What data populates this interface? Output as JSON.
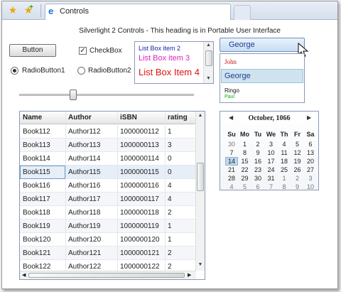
{
  "browser": {
    "tab_title": "Controls",
    "icons": [
      "favorites-star-icon",
      "add-favorite-icon",
      "ie-page-icon"
    ]
  },
  "heading": "Silverlight 2 Controls - This heading is in Portable User Interface",
  "button_label": "Button",
  "checkbox": {
    "label": "CheckBox",
    "checked": true
  },
  "radios": [
    {
      "label": "RadioButton1",
      "selected": true
    },
    {
      "label": "RadioButton2",
      "selected": false
    }
  ],
  "listbox": {
    "items": [
      {
        "label": "List Box item 2",
        "color": "#1a1aa8"
      },
      {
        "label": "List Box item 3",
        "color": "#e020c0"
      },
      {
        "label": "List Box Item 4",
        "color": "#e01010"
      }
    ]
  },
  "combobox": {
    "selected": "George",
    "options": [
      {
        "label": "John",
        "color": "#d01010"
      },
      {
        "label": "George",
        "color": "#1c3d8f"
      },
      {
        "label": "Ringo",
        "color": "#111111"
      },
      {
        "label": "Paul",
        "color": "#10b010"
      }
    ]
  },
  "slider": {
    "value_fraction": 0.32
  },
  "datagrid": {
    "columns": [
      "Name",
      "Author",
      "iSBN",
      "rating"
    ],
    "rows": [
      [
        "Book112",
        "Author112",
        "1000000112",
        "1"
      ],
      [
        "Book113",
        "Author113",
        "1000000113",
        "3"
      ],
      [
        "Book114",
        "Author114",
        "1000000114",
        "0"
      ],
      [
        "Book115",
        "Author115",
        "1000000115",
        "0"
      ],
      [
        "Book116",
        "Author116",
        "1000000116",
        "4"
      ],
      [
        "Book117",
        "Author117",
        "1000000117",
        "4"
      ],
      [
        "Book118",
        "Author118",
        "1000000118",
        "2"
      ],
      [
        "Book119",
        "Author119",
        "1000000119",
        "1"
      ],
      [
        "Book120",
        "Author120",
        "1000000120",
        "1"
      ],
      [
        "Book121",
        "Author121",
        "1000000121",
        "2"
      ],
      [
        "Book122",
        "Author122",
        "1000000122",
        "2"
      ]
    ],
    "selected_row": 3
  },
  "calendar": {
    "month_label": "October, 1066",
    "days_of_week": [
      "Su",
      "Mo",
      "Tu",
      "We",
      "Th",
      "Fr",
      "Sa"
    ],
    "weeks": [
      [
        "30",
        "1",
        "2",
        "3",
        "4",
        "5",
        "6"
      ],
      [
        "7",
        "8",
        "9",
        "10",
        "11",
        "12",
        "13"
      ],
      [
        "14",
        "15",
        "16",
        "17",
        "18",
        "19",
        "20"
      ],
      [
        "21",
        "22",
        "23",
        "24",
        "25",
        "26",
        "27"
      ],
      [
        "28",
        "29",
        "30",
        "31",
        "1",
        "2",
        "3"
      ],
      [
        "4",
        "5",
        "6",
        "7",
        "8",
        "9",
        "10"
      ]
    ],
    "today": "14"
  }
}
